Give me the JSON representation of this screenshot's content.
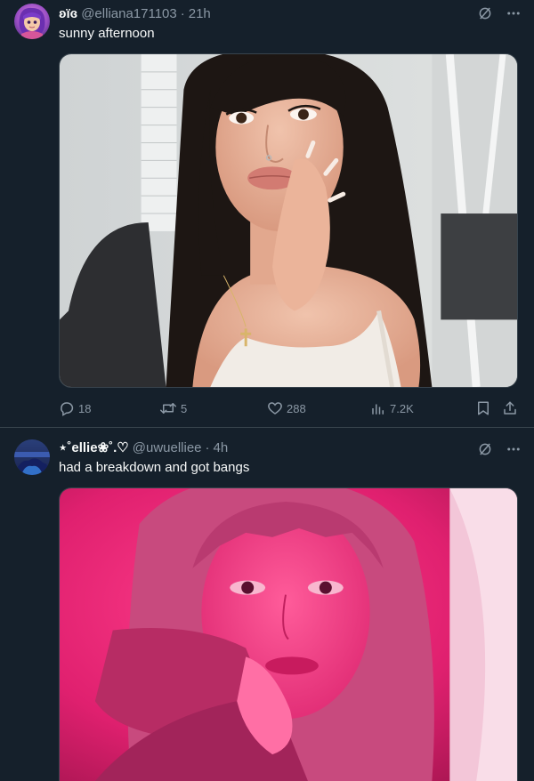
{
  "tweets": [
    {
      "display_name": "ʚïɞ",
      "handle": "@elliana171103",
      "separator": "·",
      "time": "21h",
      "text": "sunny afternoon",
      "actions": {
        "replies": "18",
        "reposts": "5",
        "likes": "288",
        "views": "7.2K"
      },
      "icons": [
        "grok-icon",
        "more-icon",
        "reply-icon",
        "repost-icon",
        "like-icon",
        "views-icon",
        "bookmark-icon",
        "share-icon"
      ]
    },
    {
      "display_name": "⋆˚ellie❀˚.♡",
      "handle": "@uwuelliee",
      "separator": "·",
      "time": "4h",
      "text": "had a breakdown and got bangs",
      "icons": [
        "grok-icon",
        "more-icon"
      ]
    }
  ],
  "colors": {
    "background": "#15202b",
    "text": "#f7f9f9",
    "secondary_text": "#8b98a5",
    "divider": "#38444d"
  }
}
